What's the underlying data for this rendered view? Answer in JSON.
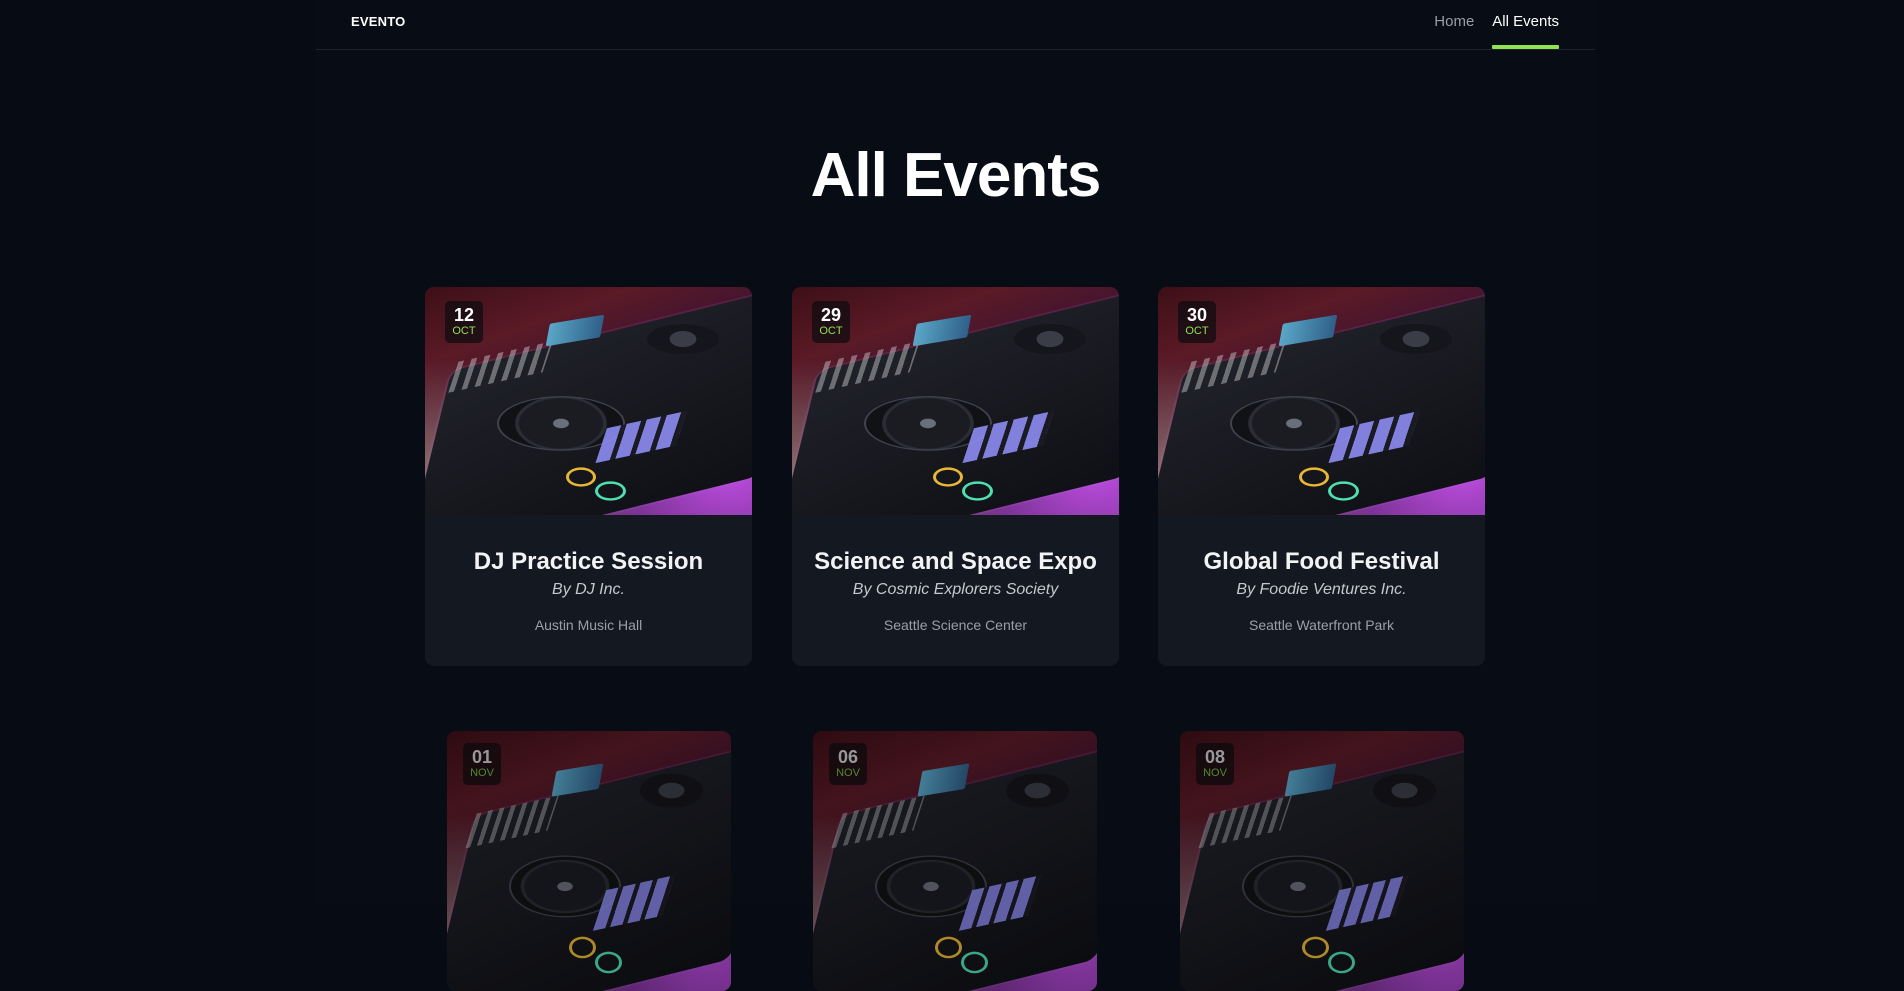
{
  "header": {
    "logo": "EVENTO",
    "nav": [
      {
        "label": "Home",
        "active": false
      },
      {
        "label": "All Events",
        "active": true
      }
    ],
    "accent_color": "#8fe34f"
  },
  "page": {
    "title": "All Events"
  },
  "events": [
    {
      "day": "12",
      "month": "OCT",
      "title": "DJ Practice Session",
      "organizer": "By DJ Inc.",
      "location": "Austin Music Hall"
    },
    {
      "day": "29",
      "month": "OCT",
      "title": "Science and Space Expo",
      "organizer": "By Cosmic Explorers Society",
      "location": "Seattle Science Center"
    },
    {
      "day": "30",
      "month": "OCT",
      "title": "Global Food Festival",
      "organizer": "By Foodie Ventures Inc.",
      "location": "Seattle Waterfront Park"
    },
    {
      "day": "01",
      "month": "NOV"
    },
    {
      "day": "06",
      "month": "NOV"
    },
    {
      "day": "08",
      "month": "NOV"
    }
  ]
}
